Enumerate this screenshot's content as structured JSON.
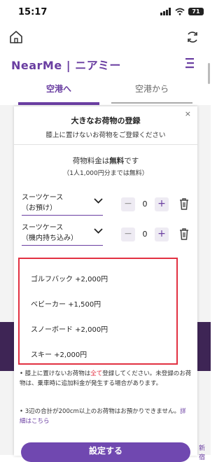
{
  "status_bar": {
    "time": "15:17",
    "battery": "71"
  },
  "header": {
    "logo": "NearMe | ニアミー",
    "home_icon": "home-icon",
    "reload_icon": "reload-icon",
    "menu_icon": "hamburger-icon"
  },
  "tabs": [
    {
      "label": "空港へ",
      "active": true
    },
    {
      "label": "空港から",
      "active": false
    }
  ],
  "modal": {
    "close": "×",
    "title": "大きなお荷物の登録",
    "subtitle": "膝上に置けないお荷物をご登録ください",
    "fee_prefix": "荷物料金は",
    "fee_bold": "無料",
    "fee_suffix": "です",
    "fee_note": "（1人1,000円分までは無料）",
    "items": [
      {
        "label_line1": "スーツケース",
        "label_line2": "（お預け）",
        "qty": "0"
      },
      {
        "label_line1": "スーツケース",
        "label_line2": "（機内持ち込み）",
        "qty": "0"
      }
    ],
    "options": [
      "ゴルフバック +2,000円",
      "ベビーカー +1,500円",
      "スノーボード +2,000円",
      "スキー +2,000円"
    ],
    "note1_a": "膝上に置けないお荷物は",
    "note1_red": "全て",
    "note1_b": "登録してください。未登録のお荷物は、乗車時に追加料金が発生する場合があります。",
    "note2_a": "3辺の合計が200cm以上のお荷物はお預かりできません。",
    "note2_link": "詳細はこちら",
    "confirm": "設定する"
  },
  "side_text": "新宿",
  "colors": {
    "brand": "#6a3ea1",
    "highlight": "#e23142",
    "band": "#3e2555"
  }
}
